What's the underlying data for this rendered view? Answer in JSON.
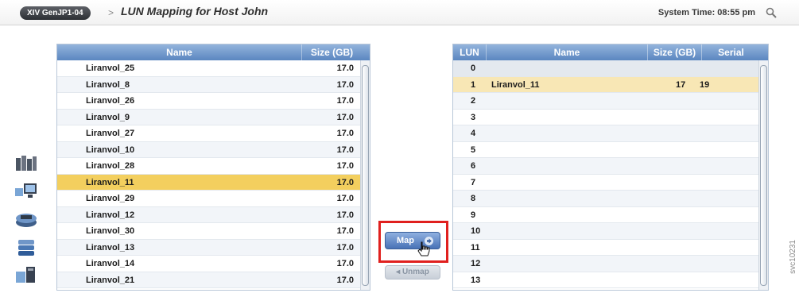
{
  "header": {
    "system_pill": "XIV GenJP1-04",
    "separator": ">",
    "title": "LUN Mapping for Host John",
    "system_time": "System Time: 08:55 pm"
  },
  "rail_icons": [
    "systems-icon",
    "hosts-icon",
    "pools-icon",
    "volumes-icon",
    "host-volume-icon"
  ],
  "volumes_table": {
    "columns": [
      "Name",
      "Size (GB)"
    ],
    "rows": [
      {
        "name": "Liranvol_25",
        "size": "17.0"
      },
      {
        "name": "Liranvol_8",
        "size": "17.0"
      },
      {
        "name": "Liranvol_26",
        "size": "17.0"
      },
      {
        "name": "Liranvol_9",
        "size": "17.0"
      },
      {
        "name": "Liranvol_27",
        "size": "17.0"
      },
      {
        "name": "Liranvol_10",
        "size": "17.0"
      },
      {
        "name": "Liranvol_28",
        "size": "17.0"
      },
      {
        "name": "Liranvol_11",
        "size": "17.0"
      },
      {
        "name": "Liranvol_29",
        "size": "17.0"
      },
      {
        "name": "Liranvol_12",
        "size": "17.0"
      },
      {
        "name": "Liranvol_30",
        "size": "17.0"
      },
      {
        "name": "Liranvol_13",
        "size": "17.0"
      },
      {
        "name": "Liranvol_14",
        "size": "17.0"
      },
      {
        "name": "Liranvol_21",
        "size": "17.0"
      }
    ],
    "selected_index": 7
  },
  "lun_table": {
    "columns": [
      "LUN",
      "Name",
      "Size (GB)",
      "Serial"
    ],
    "rows": [
      {
        "lun": "0",
        "name": "",
        "size": "",
        "serial": ""
      },
      {
        "lun": "1",
        "name": "Liranvol_11",
        "size": "17",
        "serial": "19"
      },
      {
        "lun": "2",
        "name": "",
        "size": "",
        "serial": ""
      },
      {
        "lun": "3",
        "name": "",
        "size": "",
        "serial": ""
      },
      {
        "lun": "4",
        "name": "",
        "size": "",
        "serial": ""
      },
      {
        "lun": "5",
        "name": "",
        "size": "",
        "serial": ""
      },
      {
        "lun": "6",
        "name": "",
        "size": "",
        "serial": ""
      },
      {
        "lun": "7",
        "name": "",
        "size": "",
        "serial": ""
      },
      {
        "lun": "8",
        "name": "",
        "size": "",
        "serial": ""
      },
      {
        "lun": "9",
        "name": "",
        "size": "",
        "serial": ""
      },
      {
        "lun": "10",
        "name": "",
        "size": "",
        "serial": ""
      },
      {
        "lun": "11",
        "name": "",
        "size": "",
        "serial": ""
      },
      {
        "lun": "12",
        "name": "",
        "size": "",
        "serial": ""
      },
      {
        "lun": "13",
        "name": "",
        "size": "",
        "serial": ""
      }
    ],
    "selected_index": 1
  },
  "actions": {
    "map_label": "Map",
    "unmap_label": "Unmap"
  },
  "watermark": "svc10231",
  "colors": {
    "header_blue": "#5b86c0",
    "selected_row": "#f3cf5e",
    "mapped_row": "#f8e7b5",
    "highlight_red": "#e0201e"
  }
}
